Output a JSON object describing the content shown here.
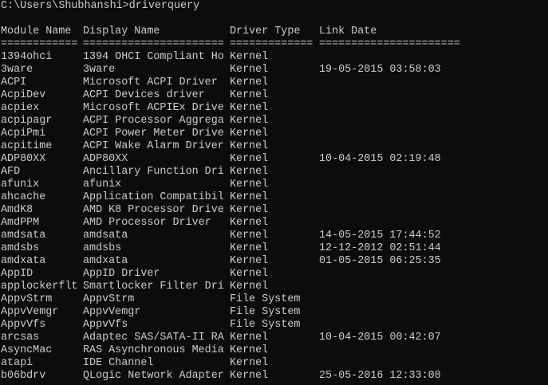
{
  "prompt": "C:\\Users\\Shubhanshi>driverquery",
  "headers": [
    "Module Name",
    "Display Name",
    "Driver Type",
    "Link Date"
  ],
  "separators": [
    "============",
    "======================",
    "=============",
    "======================"
  ],
  "rows": [
    [
      "1394ohci",
      "1394 OHCI Compliant Ho",
      "Kernel",
      ""
    ],
    [
      "3ware",
      "3ware",
      "Kernel",
      "19-05-2015 03:58:03"
    ],
    [
      "ACPI",
      "Microsoft ACPI Driver",
      "Kernel",
      ""
    ],
    [
      "AcpiDev",
      "ACPI Devices driver",
      "Kernel",
      ""
    ],
    [
      "acpiex",
      "Microsoft ACPIEx Drive",
      "Kernel",
      ""
    ],
    [
      "acpipagr",
      "ACPI Processor Aggrega",
      "Kernel",
      ""
    ],
    [
      "AcpiPmi",
      "ACPI Power Meter Drive",
      "Kernel",
      ""
    ],
    [
      "acpitime",
      "ACPI Wake Alarm Driver",
      "Kernel",
      ""
    ],
    [
      "ADP80XX",
      "ADP80XX",
      "Kernel",
      "10-04-2015 02:19:48"
    ],
    [
      "AFD",
      "Ancillary Function Dri",
      "Kernel",
      ""
    ],
    [
      "afunix",
      "afunix",
      "Kernel",
      ""
    ],
    [
      "ahcache",
      "Application Compatibil",
      "Kernel",
      ""
    ],
    [
      "AmdK8",
      "AMD K8 Processor Drive",
      "Kernel",
      ""
    ],
    [
      "AmdPPM",
      "AMD Processor Driver",
      "Kernel",
      ""
    ],
    [
      "amdsata",
      "amdsata",
      "Kernel",
      "14-05-2015 17:44:52"
    ],
    [
      "amdsbs",
      "amdsbs",
      "Kernel",
      "12-12-2012 02:51:44"
    ],
    [
      "amdxata",
      "amdxata",
      "Kernel",
      "01-05-2015 06:25:35"
    ],
    [
      "AppID",
      "AppID Driver",
      "Kernel",
      ""
    ],
    [
      "applockerflt",
      "Smartlocker Filter Dri",
      "Kernel",
      ""
    ],
    [
      "AppvStrm",
      "AppvStrm",
      "File System",
      ""
    ],
    [
      "AppvVemgr",
      "AppvVemgr",
      "File System",
      ""
    ],
    [
      "AppvVfs",
      "AppvVfs",
      "File System",
      ""
    ],
    [
      "arcsas",
      "Adaptec SAS/SATA-II RA",
      "Kernel",
      "10-04-2015 00:42:07"
    ],
    [
      "AsyncMac",
      "RAS Asynchronous Media",
      "Kernel",
      ""
    ],
    [
      "atapi",
      "IDE Channel",
      "Kernel",
      ""
    ],
    [
      "b06bdrv",
      "QLogic Network Adapter",
      "Kernel",
      "25-05-2016 12:33:08"
    ]
  ]
}
